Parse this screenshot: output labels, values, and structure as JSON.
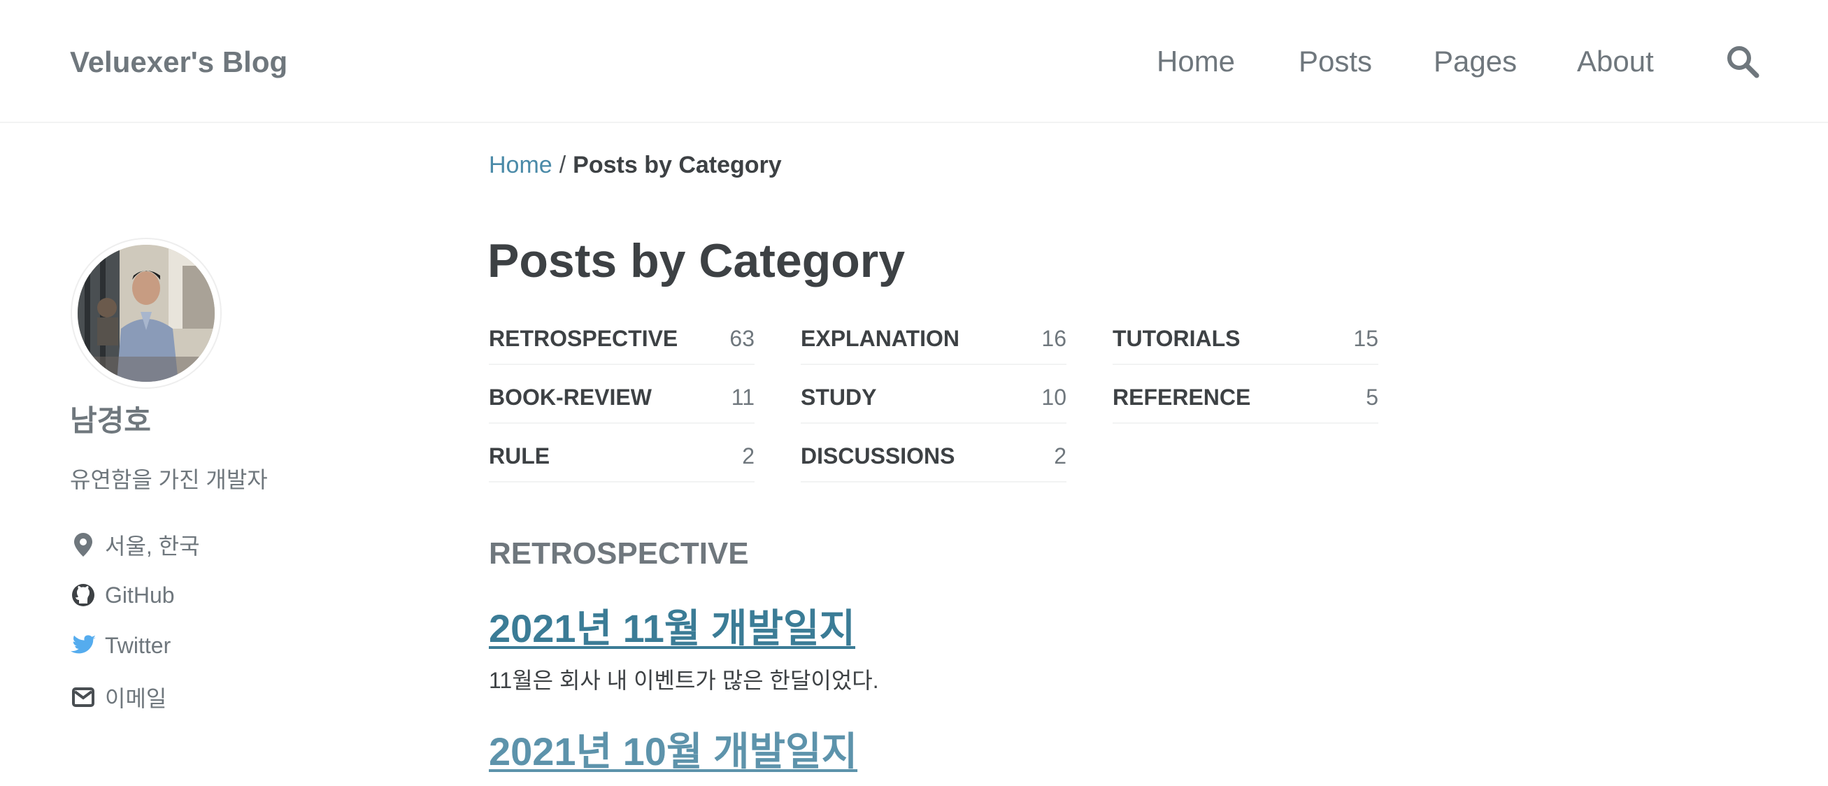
{
  "masthead": {
    "site_title": "Veluexer's Blog",
    "nav": [
      "Home",
      "Posts",
      "Pages",
      "About"
    ],
    "search_icon": "search-icon"
  },
  "breadcrumb": {
    "home": "Home",
    "separator": "/",
    "current": "Posts by Category"
  },
  "author": {
    "name": "남경호",
    "bio": "유연함을 가진 개발자",
    "links": [
      {
        "icon": "map-marker-icon",
        "label": "서울, 한국"
      },
      {
        "icon": "github-icon",
        "label": "GitHub"
      },
      {
        "icon": "twitter-icon",
        "label": "Twitter"
      },
      {
        "icon": "envelope-icon",
        "label": "이메일"
      }
    ]
  },
  "main": {
    "title": "Posts by Category",
    "categories": [
      {
        "name": "RETROSPECTIVE",
        "count": "63"
      },
      {
        "name": "EXPLANATION",
        "count": "16"
      },
      {
        "name": "TUTORIALS",
        "count": "15"
      },
      {
        "name": "BOOK-REVIEW",
        "count": "11"
      },
      {
        "name": "STUDY",
        "count": "10"
      },
      {
        "name": "REFERENCE",
        "count": "5"
      },
      {
        "name": "RULE",
        "count": "2"
      },
      {
        "name": "DISCUSSIONS",
        "count": "2"
      }
    ],
    "section_heading": "RETROSPECTIVE",
    "posts": [
      {
        "title": "2021년 11월 개발일지",
        "excerpt": "11월은 회사 내 이벤트가 많은 한달이었다."
      },
      {
        "title": "2021년 10월 개발일지"
      }
    ]
  },
  "colors": {
    "link": "#3b7c96",
    "text": "#3d4144",
    "muted": "#6f777d",
    "twitter": "#55acee"
  }
}
